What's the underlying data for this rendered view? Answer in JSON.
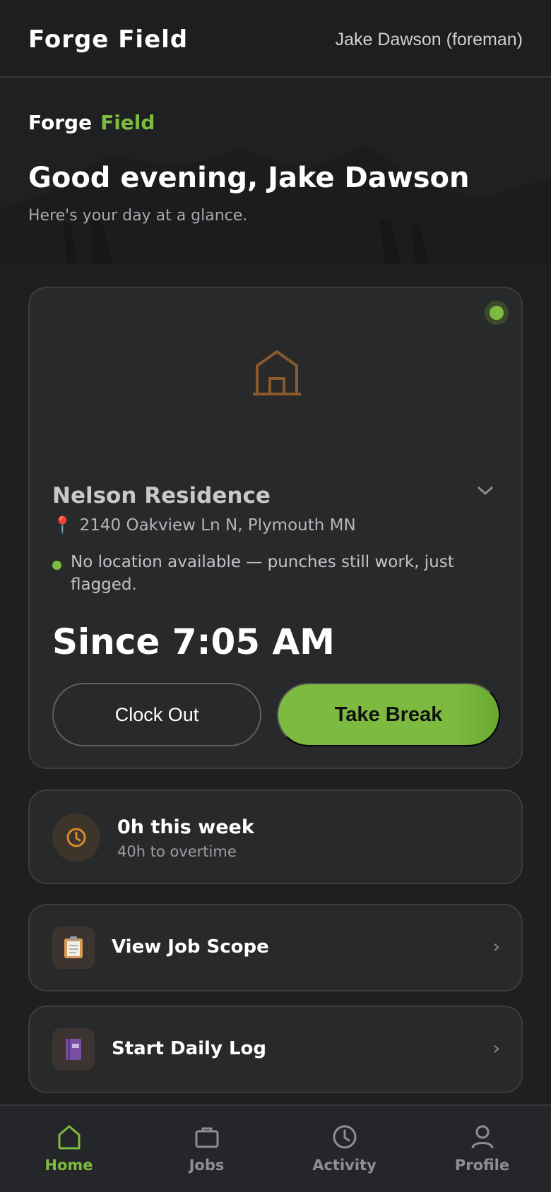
{
  "appbar": {
    "brand": "Forge Field",
    "user": "Jake Dawson (foreman)"
  },
  "hero": {
    "brand_part1": "Forge",
    "brand_part2": "Field",
    "greeting": "Good evening, Jake Dawson",
    "subtitle": "Here's your day at a glance."
  },
  "job": {
    "status": "active",
    "name": "Nelson Residence",
    "address": "2140 Oakview Ln N, Plymouth MN",
    "location_note": "No location available — punches still work, just flagged.",
    "since": "Since 7:05 AM",
    "clock_out_label": "Clock Out",
    "take_break_label": "Take Break"
  },
  "hours": {
    "title": "0h this week",
    "subtitle": "40h to overtime"
  },
  "actions": [
    {
      "label": "View Job Scope",
      "icon": "clipboard-icon"
    },
    {
      "label": "Start Daily Log",
      "icon": "notebook-icon"
    }
  ],
  "nav": [
    {
      "label": "Home",
      "icon": "home-icon",
      "active": true
    },
    {
      "label": "Jobs",
      "icon": "briefcase-icon",
      "active": false
    },
    {
      "label": "Activity",
      "icon": "clock-icon",
      "active": false
    },
    {
      "label": "Profile",
      "icon": "person-icon",
      "active": false
    }
  ],
  "colors": {
    "accent": "#7cbb3f",
    "brown": "#8a5a2b",
    "background": "#1e1f21",
    "card": "#28292b"
  }
}
